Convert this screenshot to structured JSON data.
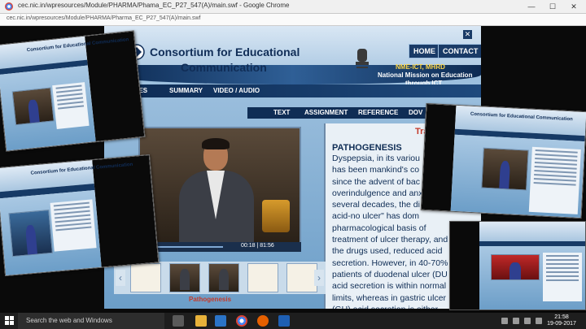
{
  "browser": {
    "window_title": "cec.nic.in/wpresources/Module/PHARMA/Phama_EC_P27_547(A)/main.swf - Google Chrome",
    "url": "cec.nic.in/wpresources/Module/PHARMA/Pharma_EC_P27_547(A)/main.swf"
  },
  "app": {
    "org_line1": "Consortium for Educational",
    "org_line2": "Communication",
    "nav_home": "HOME",
    "nav_contact": "CONTACT",
    "mission_line1": "NME-ICT, MHRD",
    "mission_line2": "National Mission on Education",
    "mission_line3": "through ICT",
    "close_label": "✕",
    "tabs": [
      "TIVES",
      "SUMMARY",
      "VIDEO  /  AUDIO"
    ],
    "subtabs": [
      "TEXT",
      "ASSIGNMENT",
      "REFERENCE",
      "DOV"
    ],
    "video_time": "00:18 | 81:56",
    "transcript_title": "Transcript",
    "transcript_heading": "PATHOGENESIS",
    "transcript_body": "Dyspepsia, in its variou\nhas been mankind's co\nsince the advent of bac\noverindulgence and anx\nseveral decades, the di\nacid-no ulcer\" has dom\npharmacological basis of\ntreatment of ulcer therapy, and\nthe drugs used, reduced acid\nsecretion. However, in 40-70%\npatients of duodenal ulcer (DU\nacid secretion is within normal\nlimits, whereas in gastric ulcer\n(GU) acid secretion is either",
    "thumb_caption": "Pathogenesis",
    "arrow_prev": "‹",
    "arrow_next": "›"
  },
  "taskbar": {
    "search_placeholder": "Search the web and Windows",
    "time": "21:58",
    "date": "19-09-2017"
  },
  "collage": {
    "mini_title": "Consortium for Educational Communication"
  }
}
